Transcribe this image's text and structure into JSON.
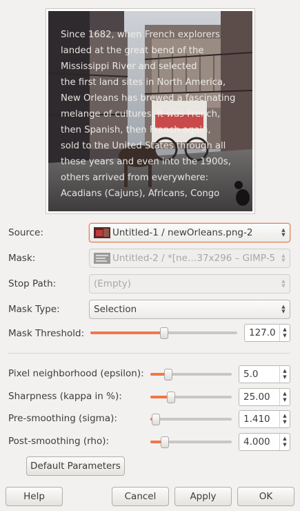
{
  "preview": {
    "overlay_lines": [
      "Since 1682, when French explorers",
      "landed at the great bend of the",
      "Mississippi River and selected",
      "the first land sites in North America,",
      "New Orleans has brewed a fascinating",
      "melange of cultures. It was French,",
      "then Spanish, then French again,",
      "sold to the United States through all",
      "these years and even into the 1900s,",
      "others arrived from everywhere:",
      "Acadians (Cajuns), Africans, Congo"
    ]
  },
  "form": {
    "source_label": "Source:",
    "source_value": "Untitled-1 / newOrleans.png-2",
    "mask_label": "Mask:",
    "mask_value": "Untitled-2 / *[ne…37x296 – GIMP-5",
    "stop_path_label": "Stop Path:",
    "stop_path_value": "(Empty)",
    "mask_type_label": "Mask Type:",
    "mask_type_value": "Selection",
    "mask_threshold_label": "Mask Threshold:",
    "mask_threshold_value": "127.0",
    "mask_threshold_fraction": 0.5
  },
  "params": [
    {
      "label": "Pixel neighborhood (epsilon):",
      "value": "5.0",
      "fraction": 0.22
    },
    {
      "label": "Sharpness (kappa in %):",
      "value": "25.00",
      "fraction": 0.25
    },
    {
      "label": "Pre-smoothing (sigma):",
      "value": "1.410",
      "fraction": 0.07
    },
    {
      "label": "Post-smoothing (rho):",
      "value": "4.000",
      "fraction": 0.18
    }
  ],
  "buttons": {
    "default_parameters": "Default Parameters",
    "help": "Help",
    "cancel": "Cancel",
    "apply": "Apply",
    "ok": "OK"
  },
  "colors": {
    "accent": "#f07746"
  }
}
